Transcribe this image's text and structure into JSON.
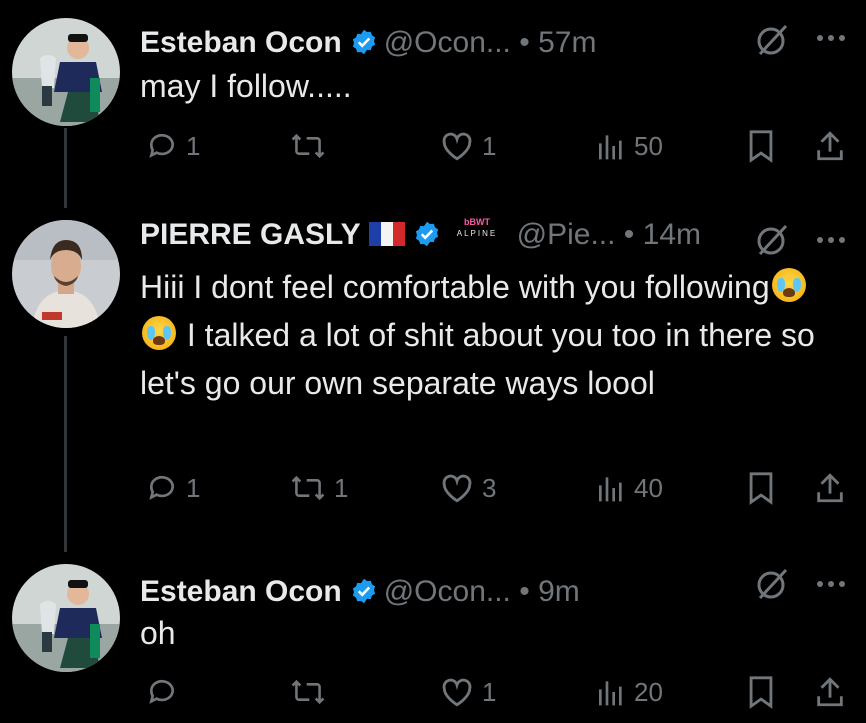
{
  "tweets": [
    {
      "name": "Esteban Ocon",
      "handle": "@Ocon...",
      "dot": "•",
      "time": "57m",
      "text": "may I follow.....",
      "replies": "1",
      "reposts": "",
      "likes": "1",
      "views": "50"
    },
    {
      "name": "PIERRE GASLY",
      "handle": "@Pie...",
      "dot": "•",
      "time": "14m",
      "text_parts": [
        "Hiii I dont feel comfortable with you following",
        " I talked a lot of shit about you too in there so let's go our own separate ways loool"
      ],
      "team_logo_text": "ALPINE",
      "replies": "1",
      "reposts": "1",
      "likes": "3",
      "views": "40"
    },
    {
      "name": "Esteban Ocon",
      "handle": "@Ocon...",
      "dot": "•",
      "time": "9m",
      "text": "oh",
      "replies": "",
      "reposts": "",
      "likes": "1",
      "views": "20"
    }
  ],
  "colors": {
    "background": "#000000",
    "text": "#e7e9ea",
    "muted": "#71767b",
    "verified": "#1d9bf0",
    "thread_line": "#333639"
  },
  "icons": [
    "verified-badge-icon",
    "grok-icon",
    "more-icon",
    "reply-icon",
    "repost-icon",
    "like-icon",
    "views-icon",
    "bookmark-icon",
    "share-icon",
    "flag-france-icon",
    "crying-emoji-icon"
  ]
}
